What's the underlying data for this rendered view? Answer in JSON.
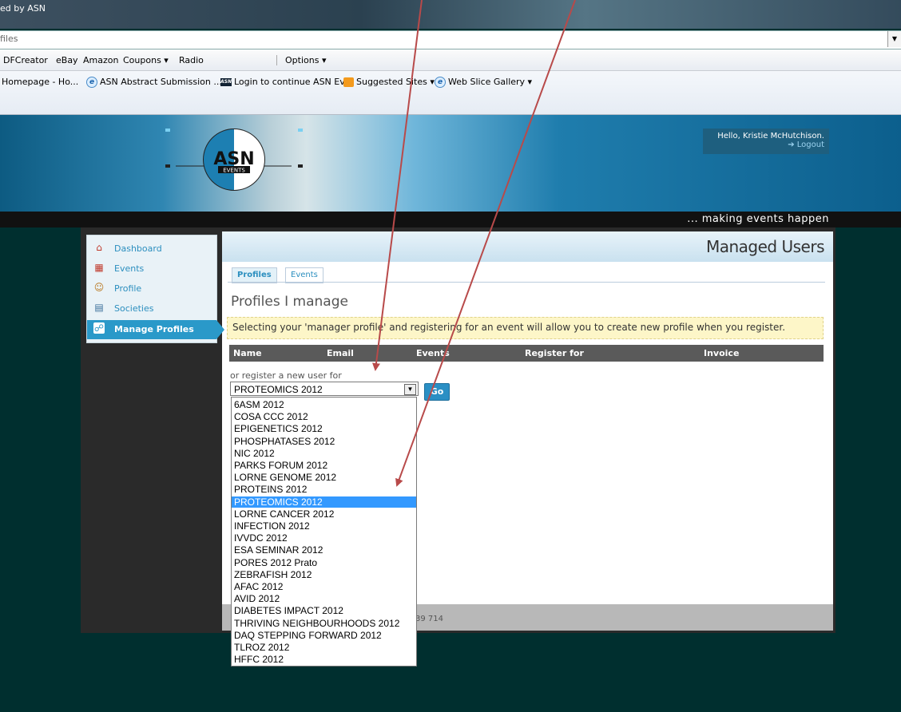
{
  "browser": {
    "title": "ed by ASN",
    "address": "files",
    "command_bar": [
      "DFCreator",
      "eBay",
      "Amazon",
      "Coupons ▾",
      "Radio",
      "Options ▾"
    ],
    "favorites": [
      "Homepage - Ho...",
      "ASN Abstract Submission ...",
      "Login to continue  ASN Ev...",
      "Suggested Sites ▾",
      "Web Slice Gallery ▾"
    ]
  },
  "header": {
    "logo_text": "ASN",
    "logo_sub": "EVENTS",
    "greeting": "Hello, Kristie McHutchison.",
    "logout": "➔ Logout",
    "tagline": "... making events happen"
  },
  "sidebar": {
    "items": [
      {
        "label": "Dashboard",
        "icon": "home-icon"
      },
      {
        "label": "Events",
        "icon": "calendar-icon"
      },
      {
        "label": "Profile",
        "icon": "person-icon"
      },
      {
        "label": "Societies",
        "icon": "card-icon"
      },
      {
        "label": "Manage Profiles",
        "icon": "people-icon",
        "active": true
      }
    ]
  },
  "main": {
    "title": "Managed Users",
    "tabs": [
      {
        "label": "Profiles",
        "active": true
      },
      {
        "label": "Events"
      }
    ],
    "heading": "Profiles I manage",
    "info": "Selecting your 'manager profile' and registering for an event will allow you to create new profile when you register.",
    "table_headers": [
      "Name",
      "Email",
      "Events",
      "Register for",
      "Invoice"
    ],
    "register_text": "or register a new user for",
    "selected_event": "PROTEOMICS 2012",
    "go_label": "Go",
    "footer_text": "39 714"
  },
  "dropdown": {
    "options": [
      "6ASM 2012",
      "COSA CCC 2012",
      "EPIGENETICS 2012",
      "PHOSPHATASES 2012",
      "NIC 2012",
      "PARKS FORUM 2012",
      "LORNE GENOME 2012",
      "PROTEINS 2012",
      "PROTEOMICS 2012",
      "LORNE CANCER 2012",
      "INFECTION 2012",
      "IVVDC 2012",
      "ESA SEMINAR 2012",
      "PORES 2012 Prato",
      "ZEBRAFISH 2012",
      "AFAC 2012",
      "AVID 2012",
      "DIABETES IMPACT 2012",
      "THRIVING NEIGHBOURHOODS 2012",
      "DAQ STEPPING FORWARD 2012",
      "TLROZ 2012",
      "HFFC 2012"
    ],
    "highlighted_index": 8
  },
  "colors": {
    "accent": "#2a99c9",
    "annotation_arrow": "#b84a4a",
    "highlight": "#3399ff",
    "page_bg": "#002f2f"
  }
}
